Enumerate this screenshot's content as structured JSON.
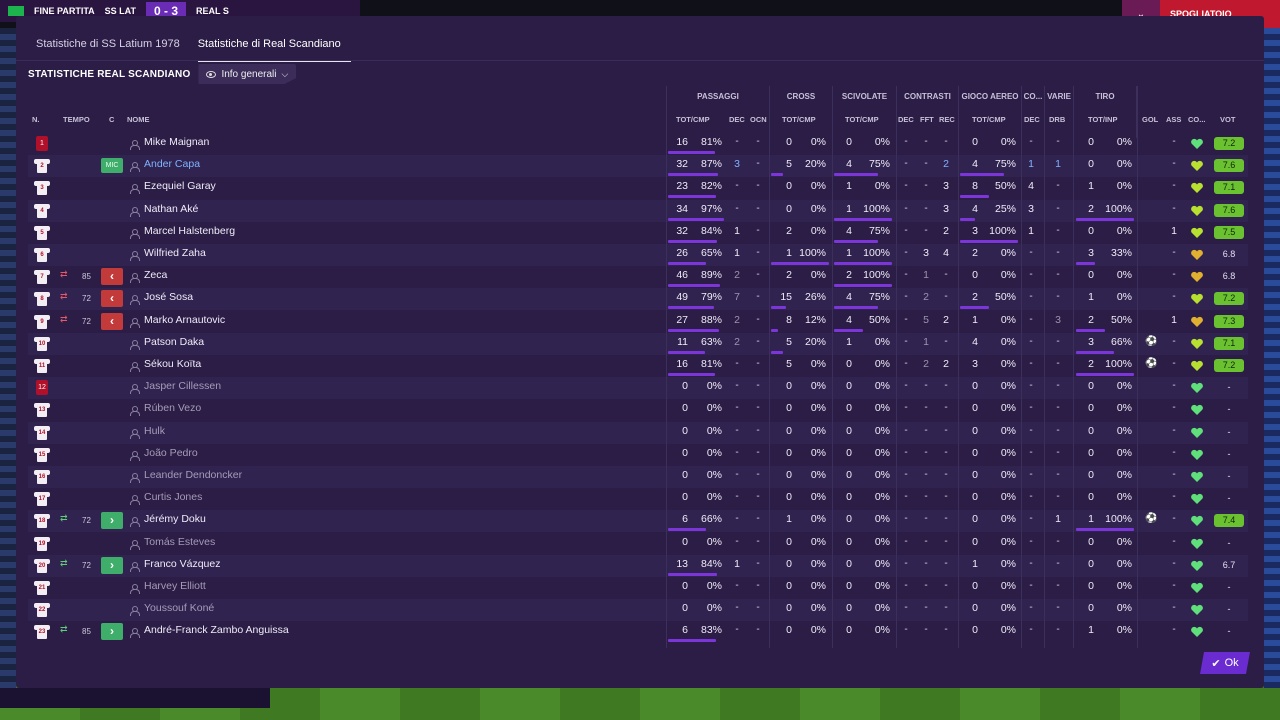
{
  "topbar": {
    "left_label": "FINE PARTITA",
    "home": "SS LAT",
    "score": "0 - 3",
    "away": "REAL S",
    "right_label": "SPOGLIATOIO",
    "right_icon": "chevron-down-icon"
  },
  "tabs": [
    {
      "label": "Statistiche di SS Latium 1978",
      "active": false
    },
    {
      "label": "Statistiche di Real Scandiano",
      "active": true
    }
  ],
  "section_title": "STATISTICHE REAL SCANDIANO",
  "view_dropdown": {
    "label": "Info generali"
  },
  "groups": {
    "passaggi": "PASSAGGI",
    "cross": "CROSS",
    "scivolate": "SCIVOLATE",
    "contrasti": "CONTRASTI",
    "gioco_aereo": "GIOCO AEREO",
    "co": "CO...",
    "varie": "VARIE",
    "tiro": "TIRO"
  },
  "columns": {
    "n": "N.",
    "tempo": "TEMPO",
    "c": "C",
    "nome": "NOME",
    "pass_totcmp": "TOT/CMP",
    "pass_dec": "DEC",
    "pass_ocn": "OCN",
    "cross_totcmp": "TOT/CMP",
    "sciv_totcmp": "TOT/CMP",
    "con_dec": "DEC",
    "con_fft": "FFT",
    "con_rec": "REC",
    "aereo_totcmp": "TOT/CMP",
    "co_dec": "DEC",
    "varie_drb": "DRB",
    "tiro_totinp": "TOT/INP",
    "gol": "GOL",
    "ass": "ASS",
    "co2": "CO...",
    "vot": "VOT"
  },
  "players": [
    {
      "num": "1",
      "gk": true,
      "name": "Mike Maignan",
      "style": "",
      "sub": "",
      "min": "",
      "pos": "",
      "p": [
        "16",
        "81%",
        "-",
        "-"
      ],
      "pb": 81,
      "cr": [
        "0",
        "0%"
      ],
      "crb": 0,
      "sc": [
        "0",
        "0%"
      ],
      "scb": 0,
      "ct": [
        "-",
        "-",
        "-"
      ],
      "ae": [
        "0",
        "0%"
      ],
      "aeb": 0,
      "co": "-",
      "drb": "-",
      "ti": [
        "0",
        "0%"
      ],
      "tib": 0,
      "gol": "",
      "ass": "-",
      "heart": "#5fe07a",
      "vote": "7.2",
      "vg": true
    },
    {
      "num": "2",
      "gk": false,
      "name": "Ander Capa",
      "style": "link",
      "sub": "",
      "min": "",
      "pos": "MIC",
      "p": [
        "32",
        "87%",
        "3",
        "-"
      ],
      "pb": 87,
      "cr": [
        "5",
        "20%"
      ],
      "crb": 20,
      "sc": [
        "4",
        "75%"
      ],
      "scb": 75,
      "ct": [
        "-",
        "-",
        "2"
      ],
      "ae": [
        "4",
        "75%"
      ],
      "aeb": 75,
      "co": "1",
      "drb": "1",
      "ti": [
        "0",
        "0%"
      ],
      "tib": 0,
      "gol": "",
      "ass": "-",
      "heart": "#b8e030",
      "vote": "7.6",
      "vg": true
    },
    {
      "num": "3",
      "gk": false,
      "name": "Ezequiel Garay",
      "style": "",
      "sub": "",
      "min": "",
      "pos": "",
      "p": [
        "23",
        "82%",
        "-",
        "-"
      ],
      "pb": 82,
      "cr": [
        "0",
        "0%"
      ],
      "crb": 0,
      "sc": [
        "1",
        "0%"
      ],
      "scb": 0,
      "ct": [
        "-",
        "-",
        "3"
      ],
      "ae": [
        "8",
        "50%"
      ],
      "aeb": 50,
      "co": "4",
      "drb": "-",
      "ti": [
        "1",
        "0%"
      ],
      "tib": 0,
      "gol": "",
      "ass": "-",
      "heart": "#b8e030",
      "vote": "7.1",
      "vg": true
    },
    {
      "num": "4",
      "gk": false,
      "name": "Nathan Aké",
      "style": "",
      "sub": "",
      "min": "",
      "pos": "",
      "p": [
        "34",
        "97%",
        "-",
        "-"
      ],
      "pb": 97,
      "cr": [
        "0",
        "0%"
      ],
      "crb": 0,
      "sc": [
        "1",
        "100%"
      ],
      "scb": 100,
      "ct": [
        "-",
        "-",
        "3"
      ],
      "ae": [
        "4",
        "25%"
      ],
      "aeb": 25,
      "co": "3",
      "drb": "-",
      "ti": [
        "2",
        "100%"
      ],
      "tib": 100,
      "gol": "",
      "ass": "-",
      "heart": "#b8e030",
      "vote": "7.6",
      "vg": true
    },
    {
      "num": "5",
      "gk": false,
      "name": "Marcel Halstenberg",
      "style": "",
      "sub": "",
      "min": "",
      "pos": "",
      "p": [
        "32",
        "84%",
        "1",
        "-"
      ],
      "pb": 84,
      "cr": [
        "2",
        "0%"
      ],
      "crb": 0,
      "sc": [
        "4",
        "75%"
      ],
      "scb": 75,
      "ct": [
        "-",
        "-",
        "2"
      ],
      "ae": [
        "3",
        "100%"
      ],
      "aeb": 100,
      "co": "1",
      "drb": "-",
      "ti": [
        "0",
        "0%"
      ],
      "tib": 0,
      "gol": "",
      "ass": "1",
      "heart": "#b8e030",
      "vote": "7.5",
      "vg": true
    },
    {
      "num": "6",
      "gk": false,
      "name": "Wilfried Zaha",
      "style": "",
      "sub": "",
      "min": "",
      "pos": "",
      "p": [
        "26",
        "65%",
        "1",
        "-"
      ],
      "pb": 65,
      "cr": [
        "1",
        "100%"
      ],
      "crb": 100,
      "sc": [
        "1",
        "100%"
      ],
      "scb": 100,
      "ct": [
        "-",
        "3",
        "4"
      ],
      "ae": [
        "2",
        "0%"
      ],
      "aeb": 0,
      "co": "-",
      "drb": "-",
      "ti": [
        "3",
        "33%"
      ],
      "tib": 33,
      "gol": "",
      "ass": "-",
      "heart": "#e0b030",
      "vote": "6.8",
      "vg": false
    },
    {
      "num": "7",
      "gk": false,
      "name": "Zeca",
      "style": "",
      "sub": "out",
      "min": "85",
      "pos": "",
      "p": [
        "46",
        "89%",
        "2",
        "-"
      ],
      "pb": 89,
      "cr": [
        "2",
        "0%"
      ],
      "crb": 0,
      "sc": [
        "2",
        "100%"
      ],
      "scb": 100,
      "ct": [
        "-",
        "1",
        "-"
      ],
      "ae": [
        "0",
        "0%"
      ],
      "aeb": 0,
      "co": "-",
      "drb": "-",
      "ti": [
        "0",
        "0%"
      ],
      "tib": 0,
      "gol": "",
      "ass": "-",
      "heart": "#e0b030",
      "vote": "6.8",
      "vg": false
    },
    {
      "num": "8",
      "gk": false,
      "name": "José Sosa",
      "style": "",
      "sub": "out",
      "min": "72",
      "pos": "",
      "p": [
        "49",
        "79%",
        "7",
        "-"
      ],
      "pb": 79,
      "cr": [
        "15",
        "26%"
      ],
      "crb": 26,
      "sc": [
        "4",
        "75%"
      ],
      "scb": 75,
      "ct": [
        "-",
        "2",
        "-"
      ],
      "ae": [
        "2",
        "50%"
      ],
      "aeb": 50,
      "co": "-",
      "drb": "-",
      "ti": [
        "1",
        "0%"
      ],
      "tib": 0,
      "gol": "",
      "ass": "-",
      "heart": "#b8e030",
      "vote": "7.2",
      "vg": true
    },
    {
      "num": "9",
      "gk": false,
      "name": "Marko Arnautovic",
      "style": "",
      "sub": "out",
      "min": "72",
      "pos": "",
      "p": [
        "27",
        "88%",
        "2",
        "-"
      ],
      "pb": 88,
      "cr": [
        "8",
        "12%"
      ],
      "crb": 12,
      "sc": [
        "4",
        "50%"
      ],
      "scb": 50,
      "ct": [
        "-",
        "5",
        "2"
      ],
      "ae": [
        "1",
        "0%"
      ],
      "aeb": 0,
      "co": "-",
      "drb": "3",
      "ti": [
        "2",
        "50%"
      ],
      "tib": 50,
      "gol": "",
      "ass": "1",
      "heart": "#e0b030",
      "vote": "7.3",
      "vg": true
    },
    {
      "num": "10",
      "gk": false,
      "name": "Patson Daka",
      "style": "",
      "sub": "",
      "min": "",
      "pos": "",
      "p": [
        "11",
        "63%",
        "2",
        "-"
      ],
      "pb": 63,
      "cr": [
        "5",
        "20%"
      ],
      "crb": 20,
      "sc": [
        "1",
        "0%"
      ],
      "scb": 0,
      "ct": [
        "-",
        "1",
        "-"
      ],
      "ae": [
        "4",
        "0%"
      ],
      "aeb": 0,
      "co": "-",
      "drb": "-",
      "ti": [
        "3",
        "66%"
      ],
      "tib": 66,
      "gol": "ball",
      "ass": "-",
      "heart": "#b8e030",
      "vote": "7.1",
      "vg": true
    },
    {
      "num": "11",
      "gk": false,
      "name": "Sékou Koïta",
      "style": "",
      "sub": "",
      "min": "",
      "pos": "",
      "p": [
        "16",
        "81%",
        "-",
        "-"
      ],
      "pb": 81,
      "cr": [
        "5",
        "0%"
      ],
      "crb": 0,
      "sc": [
        "0",
        "0%"
      ],
      "scb": 0,
      "ct": [
        "-",
        "2",
        "2"
      ],
      "ae": [
        "3",
        "0%"
      ],
      "aeb": 0,
      "co": "-",
      "drb": "-",
      "ti": [
        "2",
        "100%"
      ],
      "tib": 100,
      "gol": "ball",
      "ass": "-",
      "heart": "#b8e030",
      "vote": "7.2",
      "vg": true
    },
    {
      "num": "12",
      "gk": true,
      "name": "Jasper Cillessen",
      "style": "dim",
      "sub": "",
      "min": "",
      "pos": "",
      "p": [
        "0",
        "0%",
        "-",
        "-"
      ],
      "pb": 0,
      "cr": [
        "0",
        "0%"
      ],
      "crb": 0,
      "sc": [
        "0",
        "0%"
      ],
      "scb": 0,
      "ct": [
        "-",
        "-",
        "-"
      ],
      "ae": [
        "0",
        "0%"
      ],
      "aeb": 0,
      "co": "-",
      "drb": "-",
      "ti": [
        "0",
        "0%"
      ],
      "tib": 0,
      "gol": "",
      "ass": "-",
      "heart": "#5fe07a",
      "vote": "-",
      "vg": false
    },
    {
      "num": "13",
      "gk": false,
      "name": "Rúben Vezo",
      "style": "dim",
      "sub": "",
      "min": "",
      "pos": "",
      "p": [
        "0",
        "0%",
        "-",
        "-"
      ],
      "pb": 0,
      "cr": [
        "0",
        "0%"
      ],
      "crb": 0,
      "sc": [
        "0",
        "0%"
      ],
      "scb": 0,
      "ct": [
        "-",
        "-",
        "-"
      ],
      "ae": [
        "0",
        "0%"
      ],
      "aeb": 0,
      "co": "-",
      "drb": "-",
      "ti": [
        "0",
        "0%"
      ],
      "tib": 0,
      "gol": "",
      "ass": "-",
      "heart": "#5fe07a",
      "vote": "-",
      "vg": false
    },
    {
      "num": "14",
      "gk": false,
      "name": "Hulk",
      "style": "dim",
      "sub": "",
      "min": "",
      "pos": "",
      "p": [
        "0",
        "0%",
        "-",
        "-"
      ],
      "pb": 0,
      "cr": [
        "0",
        "0%"
      ],
      "crb": 0,
      "sc": [
        "0",
        "0%"
      ],
      "scb": 0,
      "ct": [
        "-",
        "-",
        "-"
      ],
      "ae": [
        "0",
        "0%"
      ],
      "aeb": 0,
      "co": "-",
      "drb": "-",
      "ti": [
        "0",
        "0%"
      ],
      "tib": 0,
      "gol": "",
      "ass": "-",
      "heart": "#5fe07a",
      "vote": "-",
      "vg": false
    },
    {
      "num": "15",
      "gk": false,
      "name": "João Pedro",
      "style": "dim",
      "sub": "",
      "min": "",
      "pos": "",
      "p": [
        "0",
        "0%",
        "-",
        "-"
      ],
      "pb": 0,
      "cr": [
        "0",
        "0%"
      ],
      "crb": 0,
      "sc": [
        "0",
        "0%"
      ],
      "scb": 0,
      "ct": [
        "-",
        "-",
        "-"
      ],
      "ae": [
        "0",
        "0%"
      ],
      "aeb": 0,
      "co": "-",
      "drb": "-",
      "ti": [
        "0",
        "0%"
      ],
      "tib": 0,
      "gol": "",
      "ass": "-",
      "heart": "#5fe07a",
      "vote": "-",
      "vg": false
    },
    {
      "num": "16",
      "gk": false,
      "name": "Leander Dendoncker",
      "style": "dim",
      "sub": "",
      "min": "",
      "pos": "",
      "p": [
        "0",
        "0%",
        "-",
        "-"
      ],
      "pb": 0,
      "cr": [
        "0",
        "0%"
      ],
      "crb": 0,
      "sc": [
        "0",
        "0%"
      ],
      "scb": 0,
      "ct": [
        "-",
        "-",
        "-"
      ],
      "ae": [
        "0",
        "0%"
      ],
      "aeb": 0,
      "co": "-",
      "drb": "-",
      "ti": [
        "0",
        "0%"
      ],
      "tib": 0,
      "gol": "",
      "ass": "-",
      "heart": "#5fe07a",
      "vote": "-",
      "vg": false
    },
    {
      "num": "17",
      "gk": false,
      "name": "Curtis Jones",
      "style": "dim",
      "sub": "",
      "min": "",
      "pos": "",
      "p": [
        "0",
        "0%",
        "-",
        "-"
      ],
      "pb": 0,
      "cr": [
        "0",
        "0%"
      ],
      "crb": 0,
      "sc": [
        "0",
        "0%"
      ],
      "scb": 0,
      "ct": [
        "-",
        "-",
        "-"
      ],
      "ae": [
        "0",
        "0%"
      ],
      "aeb": 0,
      "co": "-",
      "drb": "-",
      "ti": [
        "0",
        "0%"
      ],
      "tib": 0,
      "gol": "",
      "ass": "-",
      "heart": "#5fe07a",
      "vote": "-",
      "vg": false
    },
    {
      "num": "18",
      "gk": false,
      "name": "Jérémy Doku",
      "style": "",
      "sub": "in",
      "min": "72",
      "pos": "",
      "p": [
        "6",
        "66%",
        "-",
        "-"
      ],
      "pb": 66,
      "cr": [
        "1",
        "0%"
      ],
      "crb": 0,
      "sc": [
        "0",
        "0%"
      ],
      "scb": 0,
      "ct": [
        "-",
        "-",
        "-"
      ],
      "ae": [
        "0",
        "0%"
      ],
      "aeb": 0,
      "co": "-",
      "drb": "1",
      "ti": [
        "1",
        "100%"
      ],
      "tib": 100,
      "gol": "ball",
      "ass": "-",
      "heart": "#5fe07a",
      "vote": "7.4",
      "vg": true
    },
    {
      "num": "19",
      "gk": false,
      "name": "Tomás Esteves",
      "style": "dim",
      "sub": "",
      "min": "",
      "pos": "",
      "p": [
        "0",
        "0%",
        "-",
        "-"
      ],
      "pb": 0,
      "cr": [
        "0",
        "0%"
      ],
      "crb": 0,
      "sc": [
        "0",
        "0%"
      ],
      "scb": 0,
      "ct": [
        "-",
        "-",
        "-"
      ],
      "ae": [
        "0",
        "0%"
      ],
      "aeb": 0,
      "co": "-",
      "drb": "-",
      "ti": [
        "0",
        "0%"
      ],
      "tib": 0,
      "gol": "",
      "ass": "-",
      "heart": "#5fe07a",
      "vote": "-",
      "vg": false
    },
    {
      "num": "20",
      "gk": false,
      "name": "Franco Vázquez",
      "style": "",
      "sub": "in",
      "min": "72",
      "pos": "",
      "p": [
        "13",
        "84%",
        "1",
        "-"
      ],
      "pb": 84,
      "cr": [
        "0",
        "0%"
      ],
      "crb": 0,
      "sc": [
        "0",
        "0%"
      ],
      "scb": 0,
      "ct": [
        "-",
        "-",
        "-"
      ],
      "ae": [
        "1",
        "0%"
      ],
      "aeb": 0,
      "co": "-",
      "drb": "-",
      "ti": [
        "0",
        "0%"
      ],
      "tib": 0,
      "gol": "",
      "ass": "-",
      "heart": "#5fe07a",
      "vote": "6.7",
      "vg": false
    },
    {
      "num": "21",
      "gk": false,
      "name": "Harvey Elliott",
      "style": "dim",
      "sub": "",
      "min": "",
      "pos": "",
      "p": [
        "0",
        "0%",
        "-",
        "-"
      ],
      "pb": 0,
      "cr": [
        "0",
        "0%"
      ],
      "crb": 0,
      "sc": [
        "0",
        "0%"
      ],
      "scb": 0,
      "ct": [
        "-",
        "-",
        "-"
      ],
      "ae": [
        "0",
        "0%"
      ],
      "aeb": 0,
      "co": "-",
      "drb": "-",
      "ti": [
        "0",
        "0%"
      ],
      "tib": 0,
      "gol": "",
      "ass": "-",
      "heart": "#5fe07a",
      "vote": "-",
      "vg": false
    },
    {
      "num": "22",
      "gk": false,
      "name": "Youssouf Koné",
      "style": "dim",
      "sub": "",
      "min": "",
      "pos": "",
      "p": [
        "0",
        "0%",
        "-",
        "-"
      ],
      "pb": 0,
      "cr": [
        "0",
        "0%"
      ],
      "crb": 0,
      "sc": [
        "0",
        "0%"
      ],
      "scb": 0,
      "ct": [
        "-",
        "-",
        "-"
      ],
      "ae": [
        "0",
        "0%"
      ],
      "aeb": 0,
      "co": "-",
      "drb": "-",
      "ti": [
        "0",
        "0%"
      ],
      "tib": 0,
      "gol": "",
      "ass": "-",
      "heart": "#5fe07a",
      "vote": "-",
      "vg": false
    },
    {
      "num": "23",
      "gk": false,
      "name": "André-Franck Zambo Anguissa",
      "style": "",
      "sub": "in",
      "min": "85",
      "pos": "",
      "p": [
        "6",
        "83%",
        "-",
        "-"
      ],
      "pb": 83,
      "cr": [
        "0",
        "0%"
      ],
      "crb": 0,
      "sc": [
        "0",
        "0%"
      ],
      "scb": 0,
      "ct": [
        "-",
        "-",
        "-"
      ],
      "ae": [
        "0",
        "0%"
      ],
      "aeb": 0,
      "co": "-",
      "drb": "-",
      "ti": [
        "1",
        "0%"
      ],
      "tib": 0,
      "gol": "",
      "ass": "-",
      "heart": "#5fe07a",
      "vote": "-",
      "vg": false
    }
  ],
  "ok_button": {
    "label": "Ok"
  },
  "colors": {
    "panel": "#2b1d45",
    "accent": "#7b35d8",
    "vote_green": "#6bc230"
  }
}
